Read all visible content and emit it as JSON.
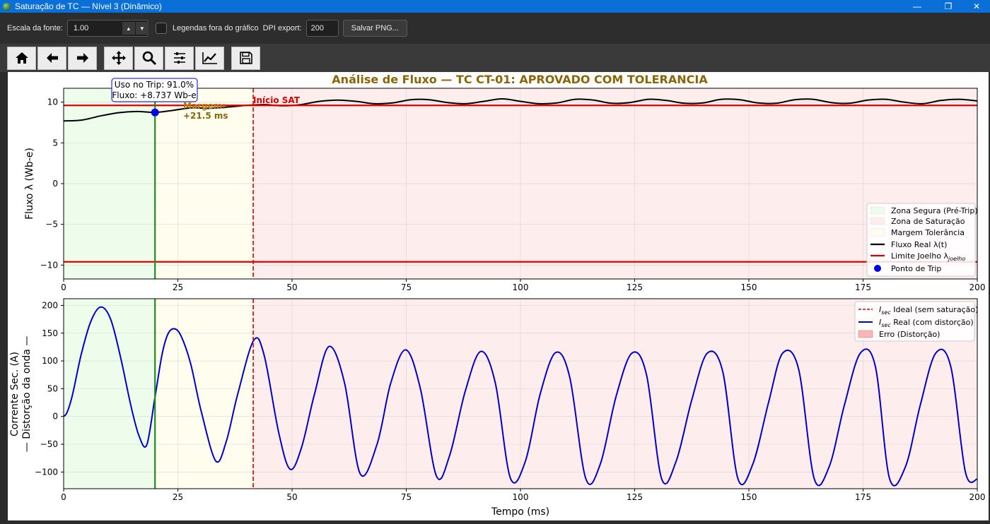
{
  "window": {
    "title": "Saturação de TC — Nível 3 (Dinâmico)",
    "minimize_glyph": "—",
    "maximize_glyph": "❐",
    "close_glyph": "✕"
  },
  "options": {
    "font_scale_label": "Escala da fonte:",
    "font_scale_value": "1.00",
    "legend_outside_label": "Legendas fora do gráfico",
    "legend_outside_checked": false,
    "dpi_label": "DPI export:",
    "dpi_value": "200",
    "save_png_label": "Salvar PNG..."
  },
  "toolbar": {
    "icons": [
      "home-icon",
      "back-arrow-icon",
      "forward-arrow-icon",
      "pan-move-icon",
      "zoom-icon",
      "configure-subplots-icon",
      "edit-axes-icon",
      "save-icon"
    ]
  },
  "figure": {
    "title": "Análise de Fluxo — TC CT-01: APROVADO COM TOLERANCIA",
    "title_color": "#8b6508",
    "tooltip_line1": "Uso no Trip: 91.0%",
    "tooltip_line2": "Fluxo: +8.737 Wb-e",
    "margin_line1": "Margem:",
    "margin_line2": "+21.5 ms",
    "sat_label": "Início SAT",
    "top_ylabel": "Fluxo λ (Wb-e)",
    "bottom_ylabel_line1": "Corrente Sec. (A)",
    "bottom_ylabel_line2": "— Distorção da onda —",
    "xlabel": "Tempo (ms)",
    "legend_top": [
      "Zona Segura (Pré-Trip)",
      "Zona de Saturação",
      "Margem Tolerância",
      "Fluxo Real λ(t)",
      "Limite Joelho λ",
      "Ponto de Trip"
    ],
    "legend_top_sub": "joelho",
    "legend_bottom": [
      "I",
      "I",
      "Erro (Distorção)"
    ],
    "legend_bottom_sub": "sec",
    "legend_bottom_suffix": [
      " Ideal (sem saturação)",
      " Real (com distorção)"
    ]
  },
  "chart_data": [
    {
      "type": "line",
      "title": "Análise de Fluxo — TC CT-01: APROVADO COM TOLERANCIA",
      "ylabel": "Fluxo λ (Wb-e)",
      "xlim": [
        0,
        200
      ],
      "ylim": [
        -11.7,
        11.7
      ],
      "xticks": [
        0,
        25,
        50,
        75,
        100,
        125,
        150,
        175,
        200
      ],
      "yticks": [
        -10,
        -5,
        0,
        5,
        10
      ],
      "grid": true,
      "legend_position": "lower-right",
      "regions": [
        {
          "name": "Zona Segura (Pré-Trip)",
          "x": [
            0,
            20
          ],
          "color": "#eefcec"
        },
        {
          "name": "Margem Tolerância",
          "x": [
            20,
            41.5
          ],
          "color": "#fefdee"
        },
        {
          "name": "Zona de Saturação",
          "x": [
            41.5,
            200
          ],
          "color": "#fdeded"
        }
      ],
      "series": [
        {
          "name": "Fluxo Real λ(t)",
          "color": "#000000",
          "x": [
            0,
            4,
            8,
            12,
            16,
            20,
            24,
            28,
            32,
            36,
            40,
            44,
            48,
            52,
            56,
            60,
            64,
            68,
            72,
            76,
            80,
            84,
            88,
            92,
            96,
            100,
            104,
            108,
            112,
            116,
            120,
            124,
            128,
            132,
            136,
            140,
            144,
            148,
            152,
            156,
            160,
            164,
            168,
            172,
            176,
            180,
            184,
            188,
            192,
            196,
            200
          ],
          "values": [
            7.7,
            7.8,
            8.3,
            8.7,
            8.85,
            8.74,
            9.0,
            9.3,
            9.25,
            9.4,
            9.6,
            9.7,
            9.55,
            9.7,
            10.1,
            10.25,
            10.1,
            9.8,
            9.9,
            10.3,
            10.3,
            9.95,
            9.8,
            10.1,
            10.4,
            10.1,
            9.8,
            9.9,
            10.35,
            10.25,
            9.85,
            9.95,
            10.35,
            10.2,
            9.85,
            9.9,
            10.35,
            10.3,
            9.9,
            9.85,
            10.3,
            10.35,
            9.95,
            9.85,
            10.25,
            10.35,
            10.0,
            9.8,
            10.2,
            10.35,
            10.15
          ]
        },
        {
          "name": "Limite Joelho λ_joelho",
          "color": "#dd0000",
          "x": [
            0,
            200
          ],
          "values": [
            9.6,
            9.6
          ]
        },
        {
          "name": "Limite Joelho (negativo)",
          "color": "#dd0000",
          "x": [
            0,
            200
          ],
          "values": [
            -9.6,
            -9.6
          ]
        }
      ],
      "vlines": [
        {
          "x": 20,
          "color": "#228b22",
          "style": "solid"
        },
        {
          "x": 41.5,
          "color": "#dd0000",
          "style": "dashed"
        }
      ],
      "trip_point": {
        "name": "Ponto de Trip",
        "x": 20,
        "y": 8.737
      }
    },
    {
      "type": "line",
      "xlabel": "Tempo (ms)",
      "ylabel": "Corrente Sec. (A) — Distorção da onda —",
      "xlim": [
        0,
        200
      ],
      "ylim": [
        -130,
        212
      ],
      "xticks": [
        0,
        25,
        50,
        75,
        100,
        125,
        150,
        175,
        200
      ],
      "yticks": [
        -100,
        -50,
        0,
        50,
        100,
        150,
        200
      ],
      "grid": true,
      "legend_position": "top-right",
      "series": [
        {
          "name": "I_sec Real (com distorção)",
          "color": "#0000cc",
          "x": [
            0,
            0.6,
            1.3,
            2.1,
            3.8,
            5.9,
            8.1,
            10.3,
            12.5,
            14.7,
            16.5,
            18.2,
            20,
            21.5,
            22.8,
            24.2,
            25.7,
            27.8,
            30.1,
            33.3,
            35.6,
            38.1,
            41.6,
            43.9,
            47.1,
            49.6,
            52.1,
            54.9,
            58.1,
            61.5,
            64.9,
            68.6,
            71.6,
            74.9,
            78.1,
            81.6,
            84.5,
            87.9,
            91.3,
            94.5,
            97.8,
            101.1,
            104.3,
            107.7,
            110.8,
            114.3,
            117.5,
            120.9,
            124.4,
            127.6,
            130.9,
            134.1,
            137.5,
            140.9,
            144.3,
            147.6,
            150.9,
            154.3,
            157.4,
            160.9,
            164.3,
            167.6,
            170.9,
            174.4,
            177.7,
            180.8,
            184.3,
            187.5,
            190.9,
            194.2,
            197.4,
            200
          ],
          "values": [
            0,
            5,
            20,
            45,
            110,
            170,
            197,
            175,
            105,
            20,
            -35,
            -51,
            35,
            110,
            148,
            158,
            145,
            95,
            10,
            -80,
            -45,
            40,
            137,
            110,
            -30,
            -95,
            -55,
            40,
            126,
            60,
            -103,
            -50,
            60,
            120,
            50,
            -107,
            -70,
            45,
            117,
            60,
            -111,
            -80,
            40,
            115,
            70,
            -112,
            -85,
            35,
            114,
            75,
            -112,
            -80,
            30,
            114,
            80,
            -112,
            -85,
            25,
            114,
            85,
            -112,
            -90,
            20,
            114,
            90,
            -112,
            -90,
            20,
            114,
            90,
            -100,
            -113
          ]
        },
        {
          "name": "I_sec Ideal (sem saturação)",
          "color": "#dd0000",
          "style": "dashed",
          "x": [],
          "values": []
        },
        {
          "name": "Erro (Distorção)",
          "color": "#f7b7b7",
          "x": [],
          "values": []
        }
      ],
      "vlines": [
        {
          "x": 20,
          "color": "#228b22",
          "style": "solid"
        },
        {
          "x": 41.5,
          "color": "#dd0000",
          "style": "dashed"
        }
      ]
    }
  ]
}
